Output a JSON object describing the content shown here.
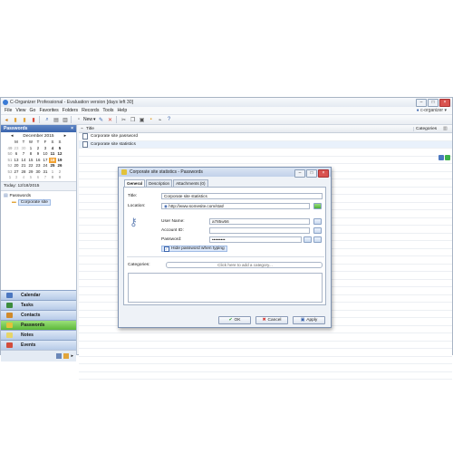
{
  "app": {
    "title": "C-Organizer Professional - Evaluation version [days left 30]",
    "profile": "c-organizer"
  },
  "menu": [
    "File",
    "View",
    "Go",
    "Favorites",
    "Folders",
    "Records",
    "Tools",
    "Help"
  ],
  "toolbar": {
    "new_label": "New"
  },
  "left": {
    "header": "Passwords",
    "calendar": {
      "month": "December 2015",
      "weekdays": [
        "M",
        "T",
        "W",
        "T",
        "F",
        "S",
        "S"
      ],
      "weeks": [
        {
          "wk": "49",
          "days": [
            "23",
            "30",
            "1",
            "2",
            "3",
            "4",
            "5"
          ]
        },
        {
          "wk": "50",
          "days": [
            "6",
            "7",
            "8",
            "9",
            "10",
            "11",
            "12"
          ]
        },
        {
          "wk": "51",
          "days": [
            "13",
            "14",
            "15",
            "16",
            "17",
            "18",
            "19"
          ]
        },
        {
          "wk": "52",
          "days": [
            "20",
            "21",
            "22",
            "23",
            "24",
            "25",
            "26"
          ]
        },
        {
          "wk": "53",
          "days": [
            "27",
            "28",
            "29",
            "30",
            "31",
            "1",
            "2"
          ]
        },
        {
          "wk": "1",
          "days": [
            "3",
            "4",
            "5",
            "6",
            "7",
            "8",
            "9"
          ]
        }
      ]
    },
    "today": "Today: 12/18/2015",
    "tree": {
      "root": "Passwords",
      "child": "Corporate site"
    },
    "nav": [
      "Calendar",
      "Tasks",
      "Contacts",
      "Passwords",
      "Notes",
      "Events"
    ]
  },
  "grid": {
    "col_title": "Title",
    "col_categories": "Categories",
    "rows": [
      "Corporate site password",
      "Corporate site statistics"
    ]
  },
  "dialog": {
    "title": "Corporate site statistics - Passwords",
    "tabs": [
      "General",
      "Description",
      "Attachments (0)"
    ],
    "title_label": "Title:",
    "title_value": "Corporate site statistics",
    "location_label": "Location:",
    "location_value": "http://www.somesite.com/stat/",
    "username_label": "User Name:",
    "username_value": "a785w56",
    "accountid_label": "Account ID:",
    "accountid_value": "",
    "password_label": "Password:",
    "password_value": "•••••••••",
    "hide_password_label": "Hide password when typing",
    "categories_label": "Categories:",
    "categories_placeholder": "Click here to add a category...",
    "ok_label": "OK",
    "cancel_label": "Cancel",
    "apply_label": "Apply"
  },
  "colors": {
    "accent_blue": "#3a64ad",
    "active_nav": "#5cb83a",
    "today_highlight": "#f2a232"
  }
}
